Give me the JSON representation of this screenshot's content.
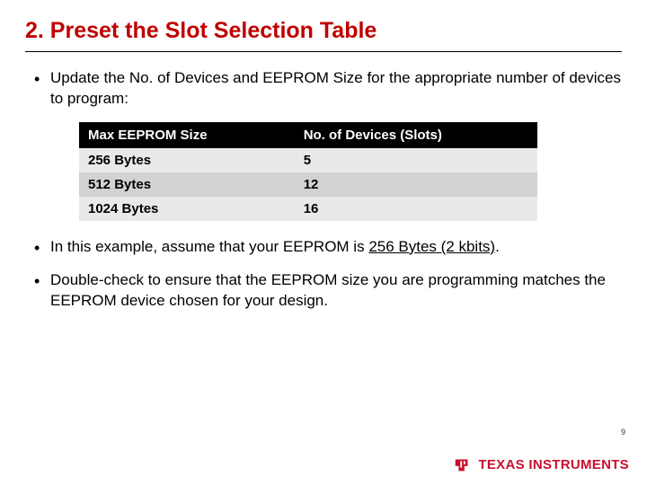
{
  "title": "2. Preset the Slot Selection Table",
  "bullets": {
    "b1": "Update the No. of Devices and EEPROM Size for the appropriate number of devices to program:",
    "b2_pre": "In this example, assume that your EEPROM is ",
    "b2_u": "256 Bytes (2 kbits)",
    "b2_post": ".",
    "b3": "Double-check to ensure that the EEPROM size you are programming matches the EEPROM device chosen for your design."
  },
  "table": {
    "headers": {
      "c1": "Max EEPROM Size",
      "c2": "No. of Devices (Slots)"
    },
    "rows": [
      {
        "c1": "256 Bytes",
        "c2": "5"
      },
      {
        "c1": "512 Bytes",
        "c2": "12"
      },
      {
        "c1": "1024 Bytes",
        "c2": "16"
      }
    ]
  },
  "footer": {
    "page": "9",
    "brand": "TEXAS INSTRUMENTS"
  }
}
